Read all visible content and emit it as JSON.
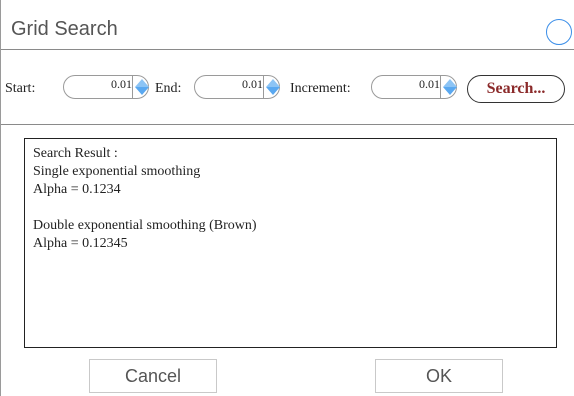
{
  "dialog": {
    "title": "Grid Search"
  },
  "toolbar": {
    "start_label": "Start:",
    "start_value": "0.01",
    "end_label": "End:",
    "end_value": "0.01",
    "increment_label": "Increment:",
    "increment_value": "0.01",
    "search_label": "Search..."
  },
  "result": {
    "lines": [
      "Search Result :",
      "Single exponential smoothing",
      "Alpha = 0.1234",
      "",
      "Double exponential smoothing (Brown)",
      "Alpha = 0.12345"
    ]
  },
  "footer": {
    "cancel_label": "Cancel",
    "ok_label": "OK"
  },
  "colors": {
    "accent": "#3b8ee8",
    "search_text": "#8b2a2a",
    "spinner_arrow": "#8cc4f5"
  },
  "icons": {
    "spinner": "up-down-arrows-icon",
    "title_control": "circle-icon"
  }
}
